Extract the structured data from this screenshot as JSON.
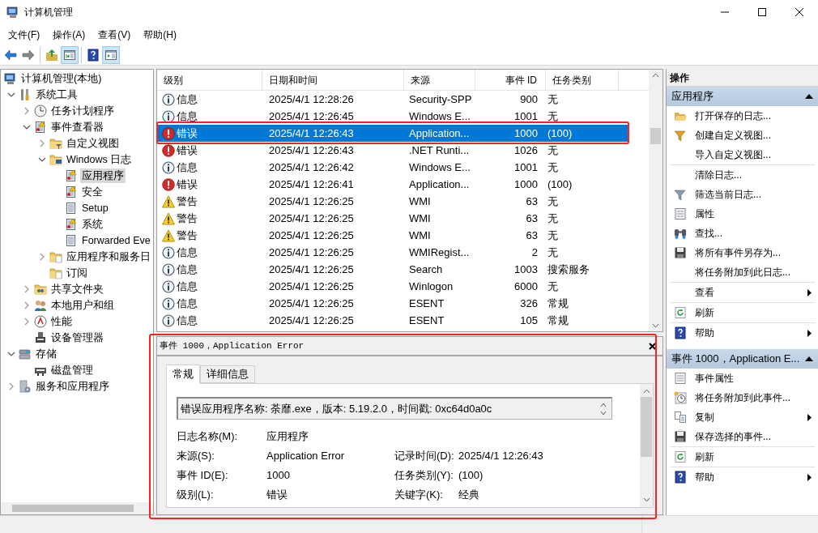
{
  "window": {
    "title": "计算机管理"
  },
  "menu": [
    "文件(F)",
    "操作(A)",
    "查看(V)",
    "帮助(H)"
  ],
  "toolbar": [
    [
      {
        "kind": "back",
        "pressed": false
      },
      {
        "kind": "forward",
        "pressed": false
      }
    ],
    [
      {
        "kind": "up",
        "pressed": false
      },
      {
        "kind": "tree_toggle",
        "pressed": true
      }
    ],
    [
      {
        "kind": "help",
        "pressed": false
      },
      {
        "kind": "action_toggle",
        "pressed": true
      }
    ]
  ],
  "tree": [
    {
      "label": "计算机管理(本地)",
      "kind": "computer",
      "selected": false,
      "children": [
        {
          "label": "系统工具",
          "kind": "tools",
          "selected": false,
          "expanded": true,
          "children": [
            {
              "label": "任务计划程序",
              "kind": "clock",
              "selected": false,
              "expanded": false
            },
            {
              "label": "事件查看器",
              "kind": "event_viewer",
              "selected": false,
              "expanded": true,
              "children": [
                {
                  "label": "自定义视图",
                  "kind": "folder_filter",
                  "selected": false,
                  "expanded": false
                },
                {
                  "label": "Windows 日志",
                  "kind": "folder_computer",
                  "selected": false,
                  "expanded": true,
                  "children": [
                    {
                      "label": "应用程序",
                      "kind": "log_warn",
                      "selected": true
                    },
                    {
                      "label": "安全",
                      "kind": "log_warn",
                      "selected": false
                    },
                    {
                      "label": "Setup",
                      "kind": "log",
                      "selected": false
                    },
                    {
                      "label": "系统",
                      "kind": "log_warn",
                      "selected": false
                    },
                    {
                      "label": "Forwarded Eve",
                      "kind": "log",
                      "selected": false
                    }
                  ]
                },
                {
                  "label": "应用程序和服务日",
                  "kind": "folder_doc",
                  "selected": false,
                  "expanded": false
                },
                {
                  "label": "订阅",
                  "kind": "folder_doc",
                  "selected": false
                }
              ]
            },
            {
              "label": "共享文件夹",
              "kind": "shared_folder",
              "selected": false,
              "expanded": false
            },
            {
              "label": "本地用户和组",
              "kind": "users",
              "selected": false,
              "expanded": false
            },
            {
              "label": "性能",
              "kind": "performance",
              "selected": false,
              "expanded": false
            },
            {
              "label": "设备管理器",
              "kind": "device",
              "selected": false
            }
          ]
        },
        {
          "label": "存储",
          "kind": "storage",
          "selected": false,
          "expanded": true,
          "children": [
            {
              "label": "磁盘管理",
              "kind": "disk",
              "selected": false
            }
          ]
        },
        {
          "label": "服务和应用程序",
          "kind": "services",
          "selected": false,
          "expanded": false
        }
      ]
    }
  ],
  "events": {
    "columns": [
      "级别",
      "日期和时间",
      "来源",
      "事件 ID",
      "任务类别"
    ],
    "rows": [
      {
        "kind": "info",
        "severity": "信息",
        "datetime": "2025/4/1 12:28:26",
        "source": "Security-SPP",
        "event_id": "900",
        "task": "无",
        "selected": false
      },
      {
        "kind": "info",
        "severity": "信息",
        "datetime": "2025/4/1 12:26:45",
        "source": "Windows E...",
        "event_id": "1001",
        "task": "无",
        "selected": false
      },
      {
        "kind": "error",
        "severity": "错误",
        "datetime": "2025/4/1 12:26:43",
        "source": "Application...",
        "event_id": "1000",
        "task": "(100)",
        "selected": true
      },
      {
        "kind": "error",
        "severity": "错误",
        "datetime": "2025/4/1 12:26:43",
        "source": ".NET Runti...",
        "event_id": "1026",
        "task": "无",
        "selected": false
      },
      {
        "kind": "info",
        "severity": "信息",
        "datetime": "2025/4/1 12:26:42",
        "source": "Windows E...",
        "event_id": "1001",
        "task": "无",
        "selected": false
      },
      {
        "kind": "error",
        "severity": "错误",
        "datetime": "2025/4/1 12:26:41",
        "source": "Application...",
        "event_id": "1000",
        "task": "(100)",
        "selected": false
      },
      {
        "kind": "warning",
        "severity": "警告",
        "datetime": "2025/4/1 12:26:25",
        "source": "WMI",
        "event_id": "63",
        "task": "无",
        "selected": false
      },
      {
        "kind": "warning",
        "severity": "警告",
        "datetime": "2025/4/1 12:26:25",
        "source": "WMI",
        "event_id": "63",
        "task": "无",
        "selected": false
      },
      {
        "kind": "warning",
        "severity": "警告",
        "datetime": "2025/4/1 12:26:25",
        "source": "WMI",
        "event_id": "63",
        "task": "无",
        "selected": false
      },
      {
        "kind": "info",
        "severity": "信息",
        "datetime": "2025/4/1 12:26:25",
        "source": "WMIRegist...",
        "event_id": "2",
        "task": "无",
        "selected": false
      },
      {
        "kind": "info",
        "severity": "信息",
        "datetime": "2025/4/1 12:26:25",
        "source": "Search",
        "event_id": "1003",
        "task": "搜索服务",
        "selected": false
      },
      {
        "kind": "info",
        "severity": "信息",
        "datetime": "2025/4/1 12:26:25",
        "source": "Winlogon",
        "event_id": "6000",
        "task": "无",
        "selected": false
      },
      {
        "kind": "info",
        "severity": "信息",
        "datetime": "2025/4/1 12:26:25",
        "source": "ESENT",
        "event_id": "326",
        "task": "常规",
        "selected": false
      },
      {
        "kind": "info",
        "severity": "信息",
        "datetime": "2025/4/1 12:26:25",
        "source": "ESENT",
        "event_id": "105",
        "task": "常规",
        "selected": false
      }
    ]
  },
  "detail": {
    "title": "事件 1000，Application Error",
    "tabs": [
      {
        "label": "常规",
        "selected": true
      },
      {
        "label": "详细信息",
        "selected": false
      }
    ],
    "message": "错误应用程序名称: 荼靡.exe，版本: 5.19.2.0，时间戳: 0xc64d0a0c",
    "fields": [
      {
        "left": {
          "label": "日志名称(M):",
          "value": "应用程序"
        }
      },
      {
        "left": {
          "label": "来源(S):",
          "value": "Application Error"
        },
        "right": {
          "label": "记录时间(D):",
          "value": "2025/4/1 12:26:43"
        }
      },
      {
        "left": {
          "label": "事件 ID(E):",
          "value": "1000"
        },
        "right": {
          "label": "任务类别(Y):",
          "value": "(100)"
        }
      },
      {
        "left": {
          "label": "级别(L):",
          "value": "错误"
        },
        "right": {
          "label": "关键字(K):",
          "value": "经典"
        }
      }
    ]
  },
  "actions": {
    "title": "操作",
    "sections": [
      {
        "title": "应用程序",
        "expanded": true,
        "items": [
          {
            "label": "打开保存的日志...",
            "kind": "open_folder",
            "submenu": false,
            "separator_after": false
          },
          {
            "label": "创建自定义视图...",
            "kind": "filter_new",
            "submenu": false,
            "separator_after": false
          },
          {
            "label": "导入自定义视图...",
            "submenu": false,
            "separator_after": true
          },
          {
            "label": "清除日志...",
            "submenu": false,
            "separator_after": false
          },
          {
            "label": "筛选当前日志...",
            "kind": "filter",
            "submenu": false,
            "separator_after": false
          },
          {
            "label": "属性",
            "kind": "properties",
            "submenu": false,
            "separator_after": false
          },
          {
            "label": "查找...",
            "kind": "binoculars",
            "submenu": false,
            "separator_after": false
          },
          {
            "label": "将所有事件另存为...",
            "kind": "save",
            "submenu": false,
            "separator_after": false
          },
          {
            "label": "将任务附加到此日志...",
            "submenu": false,
            "separator_after": true
          },
          {
            "label": "查看",
            "submenu": true,
            "separator_after": true
          },
          {
            "label": "刷新",
            "kind": "refresh",
            "submenu": false,
            "separator_after": true
          },
          {
            "label": "帮助",
            "kind": "help",
            "submenu": true,
            "separator_after": false
          }
        ]
      },
      {
        "title": "事件 1000，Application E...",
        "expanded": true,
        "items": [
          {
            "label": "事件属性",
            "kind": "properties",
            "submenu": false,
            "separator_after": false
          },
          {
            "label": "将任务附加到此事件...",
            "kind": "task_clock",
            "submenu": false,
            "separator_after": false
          },
          {
            "label": "复制",
            "kind": "copy",
            "submenu": true,
            "separator_after": false
          },
          {
            "label": "保存选择的事件...",
            "kind": "save",
            "submenu": false,
            "separator_after": true
          },
          {
            "label": "刷新",
            "kind": "refresh",
            "submenu": false,
            "separator_after": true
          },
          {
            "label": "帮助",
            "kind": "help",
            "submenu": true,
            "separator_after": false
          }
        ]
      }
    ]
  }
}
